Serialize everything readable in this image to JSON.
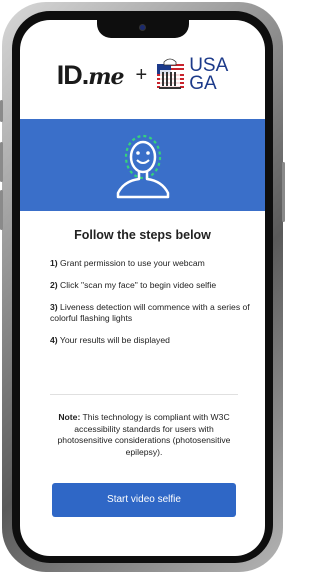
{
  "branding": {
    "idme_main": "ID.",
    "idme_suffix": "me",
    "plus": "+",
    "partner_line1": "USA",
    "partner_line2": "GA"
  },
  "colors": {
    "primary_blue": "#3a6fc9",
    "button_blue": "#2f67c6",
    "face_outline_green": "#35d37b"
  },
  "hero": {
    "icon": "face-scan-icon"
  },
  "steps": {
    "title": "Follow the steps below",
    "items": [
      {
        "number": "1)",
        "text": " Grant permission to use your webcam"
      },
      {
        "number": "2)",
        "text": " Click \"scan my face\" to begin video selfie"
      },
      {
        "number": "3)",
        "text": " Liveness detection will commence with a series of colorful flashing lights"
      },
      {
        "number": "4)",
        "text": " Your results will be displayed"
      }
    ]
  },
  "note": {
    "label": "Note:",
    "text": " This technology is compliant with W3C accessibility standards for users with photosensitive considerations (photosensitive epilepsy)."
  },
  "cta": {
    "label": "Start video selfie"
  }
}
